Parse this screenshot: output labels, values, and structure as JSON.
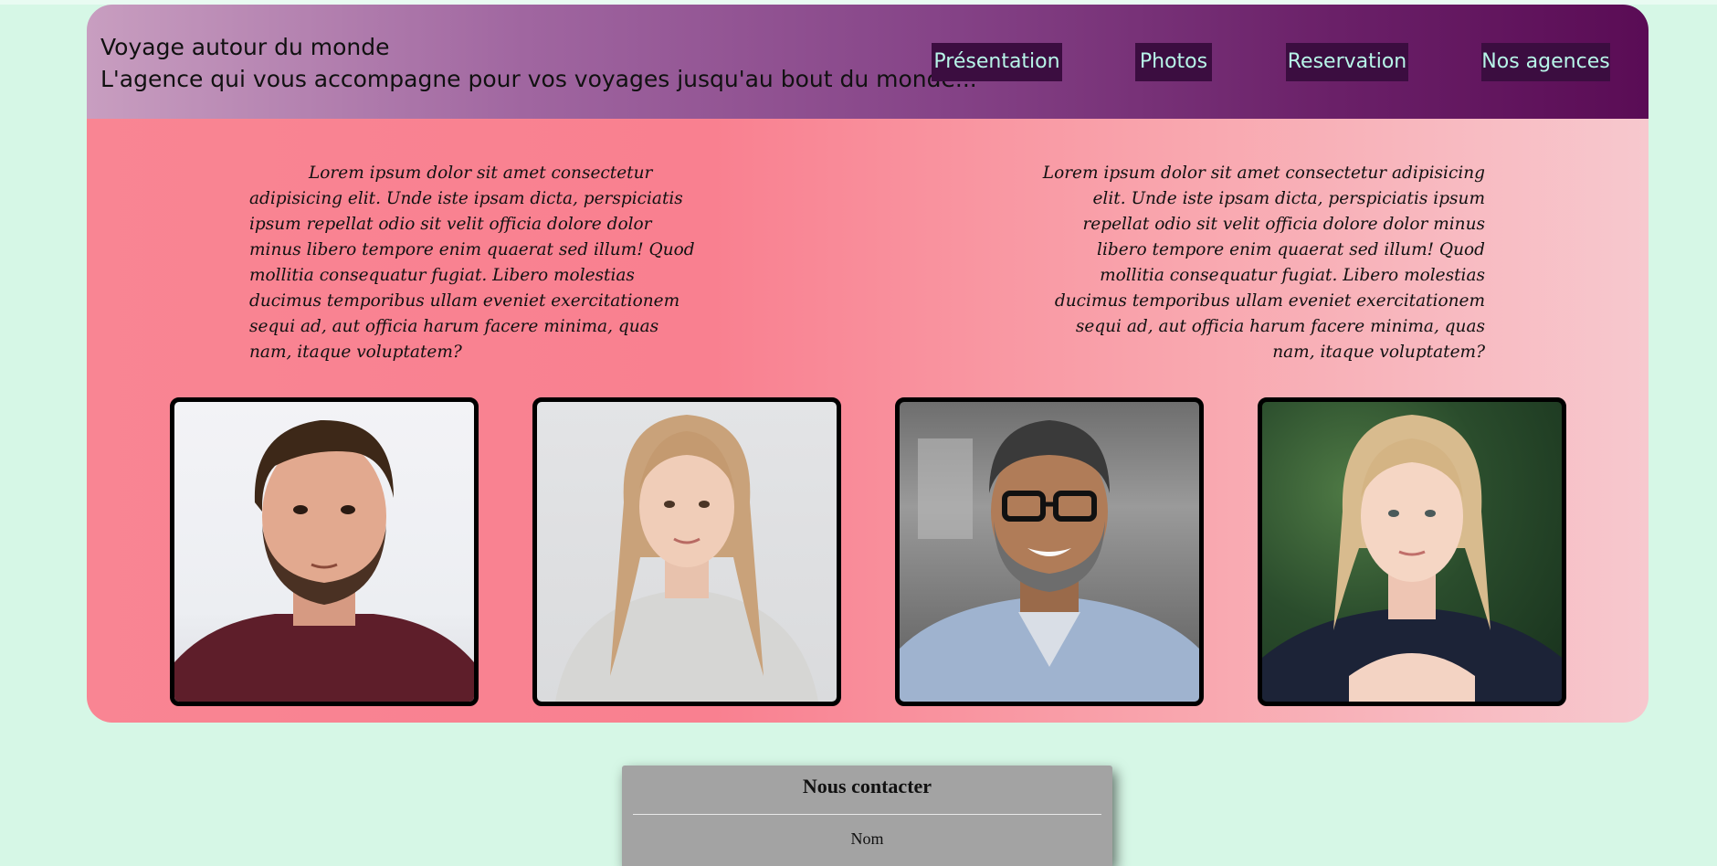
{
  "header": {
    "title": "Voyage autour du monde",
    "subtitle": "L'agence qui vous accompagne pour vos voyages jusqu'au bout du monde..."
  },
  "nav": [
    {
      "label": "Présentation"
    },
    {
      "label": "Photos"
    },
    {
      "label": "Reservation"
    },
    {
      "label": "Nos agences"
    }
  ],
  "intro": {
    "left_text": "Lorem ipsum dolor sit amet consectetur adipisicing elit. Unde iste ipsam dicta, perspiciatis ipsum repellat odio sit velit officia dolore dolor minus libero tempore enim quaerat sed illum! Quod mollitia consequatur fugiat. Libero molestias ducimus temporibus ullam eveniet exercitationem sequi ad, aut officia harum facere minima, quas nam, itaque voluptatem?",
    "right_text": "Lorem ipsum dolor sit amet consectetur adipisicing elit. Unde iste ipsam dicta, perspiciatis ipsum repellat odio sit velit officia dolore dolor minus libero tempore enim quaerat sed illum! Quod mollitia consequatur fugiat. Libero molestias ducimus temporibus ullam eveniet exercitationem sequi ad, aut officia harum facere minima, quas nam, itaque voluptatem?"
  },
  "team_photos": [
    {
      "icon": "man-beard-portrait"
    },
    {
      "icon": "woman-blonde-portrait"
    },
    {
      "icon": "man-glasses-portrait"
    },
    {
      "icon": "woman-portrait-outdoor"
    }
  ],
  "contact": {
    "title": "Nous contacter",
    "name_label": "Nom"
  },
  "colors": {
    "page_background": "#d6f7e6",
    "nav_background": "#3b0d40",
    "nav_text": "#b7f5e8"
  }
}
